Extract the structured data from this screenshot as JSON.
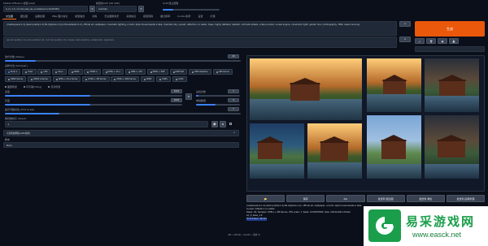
{
  "top": {
    "model_label": "Stable Diffusion 模型(ckpt)",
    "model_value": "xl_v1 | 1-4 | 1.0 sdxl_base_vae_v1.safetensors [31e35c80fc]",
    "vae_label": "模型的VAE (SD VAE)",
    "vae_value": "Automatic",
    "clip_label": "CLIP 终止层数",
    "tabs": [
      "文生图",
      "图生图",
      "后期处理",
      "PNG 图片信息",
      "模型融合",
      "训练",
      "无边图像浏览",
      "系统信息",
      "模型转换",
      "超分辨率",
      "Civitai 助手",
      "设置",
      "扩展"
    ]
  },
  "prompt": {
    "text": "(masterpiece:1.2),(best quality:1.2),8k,(highres:1.2),(ultra-detailed:1.2), official art, wallpaper, cinematic lighting, a tudor style house beside a lake, dramatic sky, sunset, reflection on water, trees, highly detailed, realistic, intricate details, octane render, unreal engine, volumetric light, golden hour, photography, HDR, award winning",
    "negative": "(worst quality:1.4), (low quality:1.4), (normal quality:1.4), lowres, bad anatomy, watermark, signature"
  },
  "generate_label": "生成",
  "settings": {
    "sampling_steps_label": "迭代步数 (Steps)",
    "sampling_steps_value": "20",
    "sampler_label": "采样方法 (Sampler)",
    "samplers": [
      "Euler a",
      "Euler",
      "LMS",
      "Heun",
      "DPM2",
      "DPM2 a",
      "DPM++ 2S a",
      "DPM++ 2M",
      "DPM++ SDE",
      "DPM fast",
      "DPM adaptive",
      "LMS Karras",
      "DPM2 Karras",
      "DPM2 a Karras",
      "DPM++ 2S a Karras",
      "DPM++ 2M Karras",
      "DPM++ SDE Karras",
      "DDIM",
      "PLMS",
      "UniPC"
    ],
    "checks": [
      "面部修复",
      "可平铺(Tiling)",
      "高清修复"
    ],
    "width_label": "宽度",
    "width_value": "1024",
    "height_label": "高度",
    "height_value": "1024",
    "batch_count_label": "总批次数",
    "batch_count_value": "1",
    "batch_size_label": "单批数量",
    "batch_size_value": "4",
    "cfg_label": "提示词相关性 (CFG Scale)",
    "cfg_value": "7",
    "seed_label": "随机数种子 (Seed)",
    "seed_value": "-1",
    "script_label": "可选附加网络(LoRA插件)",
    "script2_label": "脚本",
    "script2_value": "None"
  },
  "actions": [
    "📂",
    "保存",
    "Zip",
    "发送到 图生图",
    "发送到 重绘",
    "发送到 后期处理"
  ],
  "info": {
    "line1": "(masterpiece:1.2),(best quality:1.2),8k,(highres:1.2), official art, wallpaper, a tudor style house beside a lake, sunset, reflection on water",
    "line2": "Steps: 20, Sampler: DPM++ 2M Karras, CFG scale: 7, Seed: 1234567890, Size: 1024x1024, Model: sd_xl_base_1.0",
    "line3": "Time taken: 48.21s"
  },
  "footer": "API • Github • Gradio • 重启 UI",
  "watermark": {
    "title": "易采游戏网",
    "url": "www.easck.net"
  }
}
